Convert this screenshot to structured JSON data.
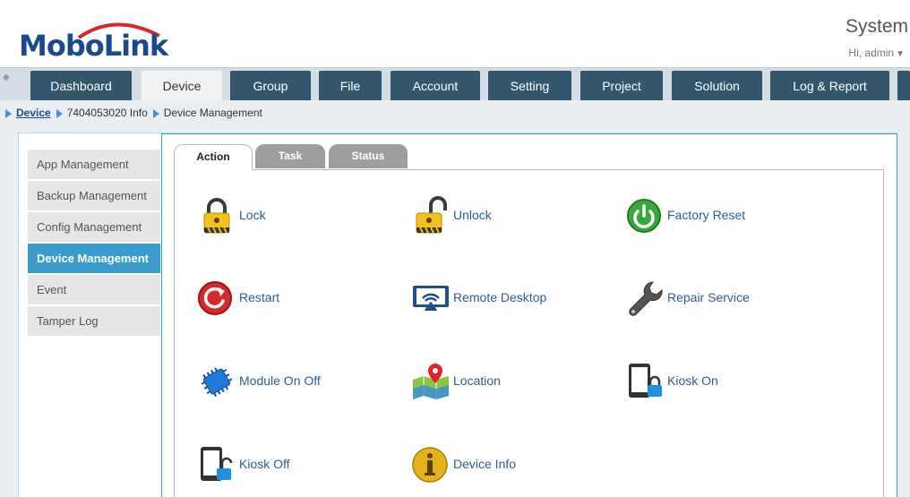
{
  "header": {
    "logo_text": "MoboLink",
    "system_title": "System",
    "greeting": "Hi, admin"
  },
  "nav": {
    "tabs": [
      {
        "label": "Dashboard"
      },
      {
        "label": "Device"
      },
      {
        "label": "Group"
      },
      {
        "label": "File"
      },
      {
        "label": "Account"
      },
      {
        "label": "Setting"
      },
      {
        "label": "Project"
      },
      {
        "label": "Solution"
      },
      {
        "label": "Log & Report"
      }
    ],
    "active": "Device"
  },
  "breadcrumb": {
    "items": [
      "Device",
      "7404053020 Info",
      "Device Management"
    ]
  },
  "sidebar": {
    "items": [
      {
        "label": "App Management"
      },
      {
        "label": "Backup Management"
      },
      {
        "label": "Config Management"
      },
      {
        "label": "Device Management"
      },
      {
        "label": "Event"
      },
      {
        "label": "Tamper Log"
      }
    ],
    "active": "Device Management"
  },
  "subtabs": {
    "items": [
      {
        "label": "Action"
      },
      {
        "label": "Task"
      },
      {
        "label": "Status"
      }
    ],
    "active": "Action"
  },
  "actions": [
    {
      "label": "Lock",
      "icon": "lock-icon"
    },
    {
      "label": "Unlock",
      "icon": "unlock-icon"
    },
    {
      "label": "Factory Reset",
      "icon": "power-icon"
    },
    {
      "label": "Restart",
      "icon": "restart-icon"
    },
    {
      "label": "Remote Desktop",
      "icon": "remote-desktop-icon"
    },
    {
      "label": "Repair Service",
      "icon": "wrench-icon"
    },
    {
      "label": "Module On Off",
      "icon": "chip-icon"
    },
    {
      "label": "Location",
      "icon": "map-pin-icon"
    },
    {
      "label": "Kiosk On",
      "icon": "tablet-lock-icon"
    },
    {
      "label": "Kiosk Off",
      "icon": "tablet-unlock-icon"
    },
    {
      "label": "Device Info",
      "icon": "info-icon"
    }
  ],
  "colors": {
    "brand_blue": "#1a4a8c",
    "nav_tab": "#33566b",
    "active_side": "#3a9ccc",
    "link": "#2b5d9a"
  }
}
